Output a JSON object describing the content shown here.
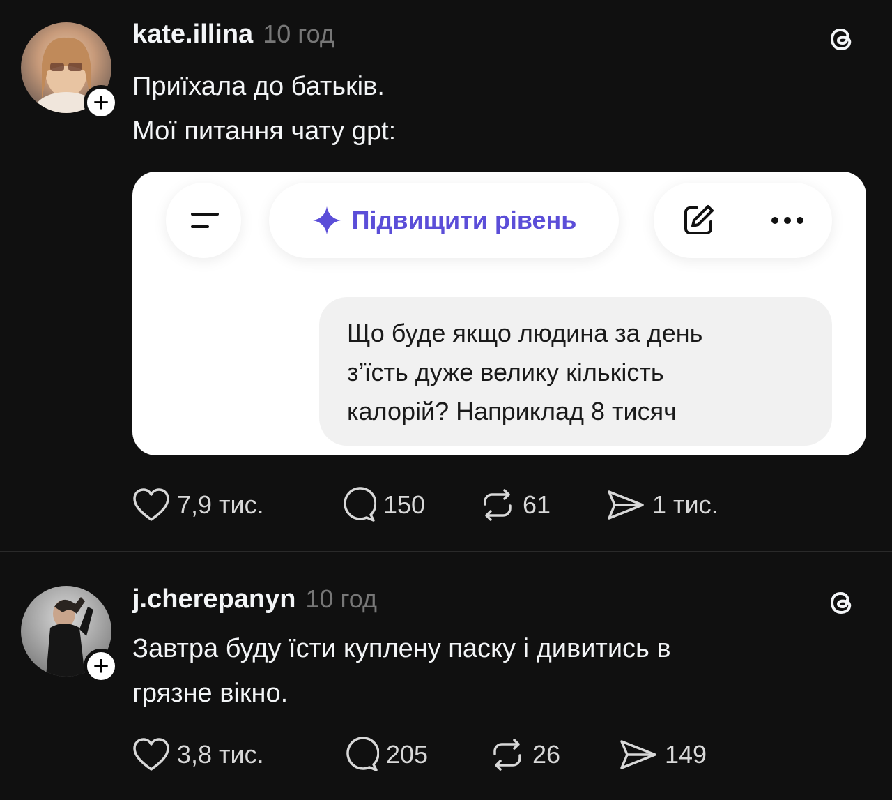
{
  "posts": [
    {
      "username": "kate.illina",
      "time": "10 год",
      "text_lines": [
        "Приїхала до батьків.",
        "Мої питання чату gpt:"
      ],
      "embed": {
        "upgrade_label": "Підвищити рівень",
        "message_lines": [
          "Що буде якщо людина за день",
          "з’їсть дуже велику кількість",
          "калорій? Наприклад 8 тисяч"
        ]
      },
      "stats": {
        "likes": "7,9 тис.",
        "replies": "150",
        "reposts": "61",
        "shares": "1 тис."
      }
    },
    {
      "username": "j.cherepanyn",
      "time": "10 год",
      "text_lines": [
        "Завтра буду їсти куплену паску і дивитись в",
        "грязне вікно."
      ],
      "stats": {
        "likes": "3,8 тис.",
        "replies": "205",
        "reposts": "26",
        "shares": "149"
      }
    }
  ],
  "colors": {
    "background": "#101010",
    "text": "#f3f5f7",
    "muted": "#777777",
    "accent": "#5b4ed8"
  },
  "icons": [
    "threads-icon",
    "follow-plus-icon",
    "heart-icon",
    "reply-icon",
    "repost-icon",
    "share-icon",
    "menu-icon",
    "sparkle-icon",
    "edit-icon",
    "more-icon"
  ]
}
